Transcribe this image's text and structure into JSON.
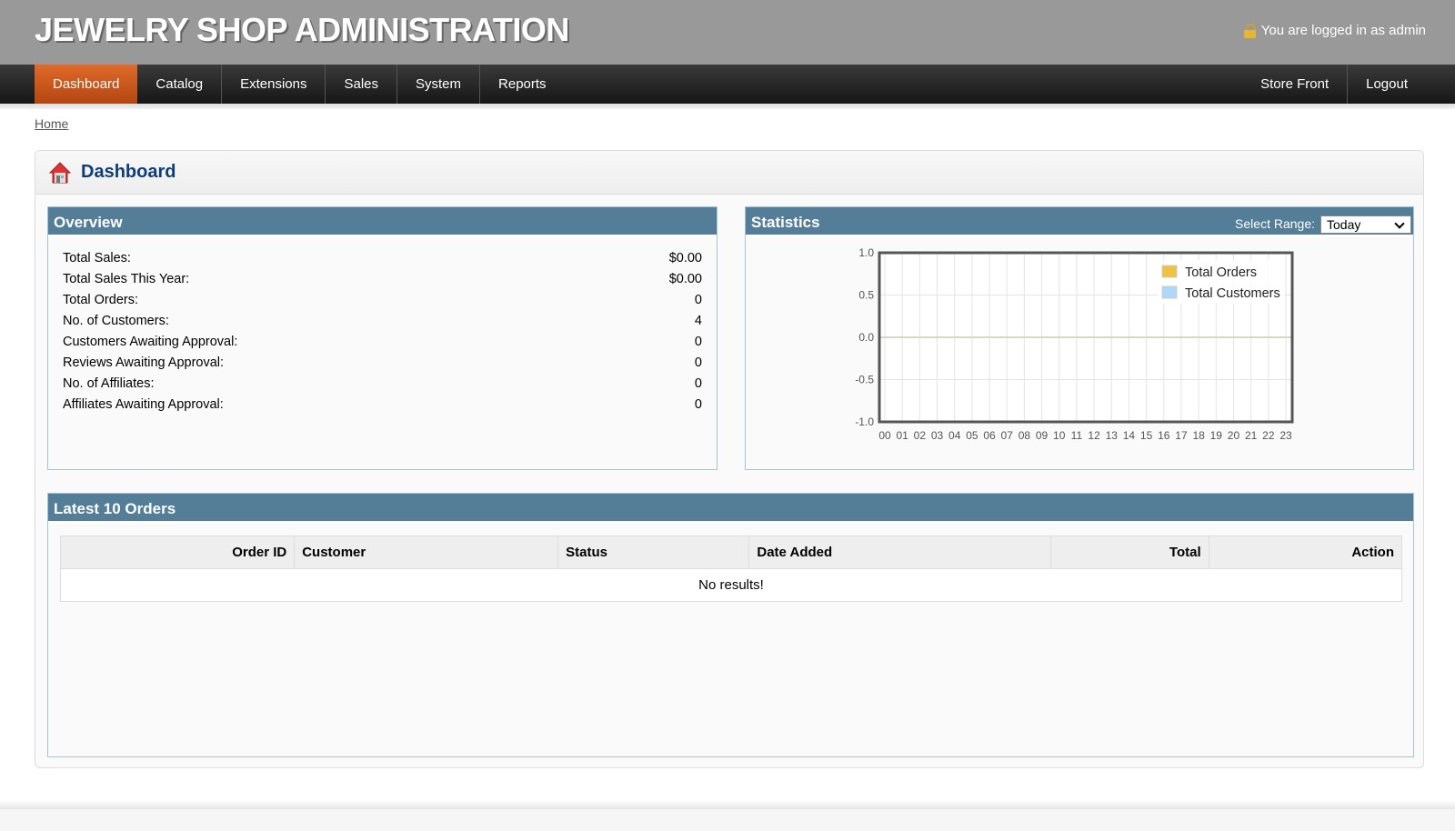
{
  "header": {
    "title": "JEWELRY SHOP ADMINISTRATION",
    "login_text": "You are logged in as admin"
  },
  "nav": {
    "items": [
      "Dashboard",
      "Catalog",
      "Extensions",
      "Sales",
      "System",
      "Reports"
    ],
    "right": [
      "Store Front",
      "Logout"
    ],
    "active": "Dashboard"
  },
  "breadcrumb": "Home",
  "page_title": "Dashboard",
  "overview": {
    "title": "Overview",
    "rows": [
      {
        "label": "Total Sales:",
        "value": "$0.00"
      },
      {
        "label": "Total Sales This Year:",
        "value": "$0.00"
      },
      {
        "label": "Total Orders:",
        "value": "0"
      },
      {
        "label": "No. of Customers:",
        "value": "4"
      },
      {
        "label": "Customers Awaiting Approval:",
        "value": "0"
      },
      {
        "label": "Reviews Awaiting Approval:",
        "value": "0"
      },
      {
        "label": "No. of Affiliates:",
        "value": "0"
      },
      {
        "label": "Affiliates Awaiting Approval:",
        "value": "0"
      }
    ]
  },
  "statistics": {
    "title": "Statistics",
    "range_label": "Select Range:",
    "range_value": "Today"
  },
  "chart_data": {
    "type": "line",
    "x": [
      "00",
      "01",
      "02",
      "03",
      "04",
      "05",
      "06",
      "07",
      "08",
      "09",
      "10",
      "11",
      "12",
      "13",
      "14",
      "15",
      "16",
      "17",
      "18",
      "19",
      "20",
      "21",
      "22",
      "23"
    ],
    "yticks": [
      "1.0",
      "0.5",
      "0.0",
      "-0.5",
      "-1.0"
    ],
    "ylim": [
      -1,
      1
    ],
    "grid": true,
    "legend_placement": "top-right",
    "series": [
      {
        "name": "Total Orders",
        "color": "#edc240",
        "values": []
      },
      {
        "name": "Total Customers",
        "color": "#afd8f8",
        "values": []
      }
    ]
  },
  "orders": {
    "title": "Latest 10 Orders",
    "columns": [
      "Order ID",
      "Customer",
      "Status",
      "Date Added",
      "Total",
      "Action"
    ],
    "empty": "No results!"
  }
}
